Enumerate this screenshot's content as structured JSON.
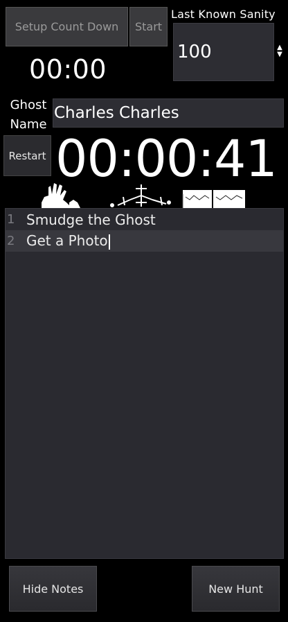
{
  "header": {
    "setup_countdown_label": "Setup Count Down",
    "start_label": "Start",
    "countdown_display": "00:00",
    "sanity_label": "Last Known Sanity",
    "sanity_value": "100"
  },
  "ghost": {
    "name_label": "Ghost\nName",
    "name_value": "Charles Charles"
  },
  "timer": {
    "restart_label": "Restart",
    "elapsed": "00:00:41"
  },
  "evidence": {
    "icons": [
      "handprint-icon",
      "ghost-orb-icon",
      "ghost-writing-icon"
    ]
  },
  "notes": {
    "lines": [
      {
        "number": "1",
        "text": "Smudge the Ghost"
      },
      {
        "number": "2",
        "text": "Get a Photo"
      }
    ]
  },
  "footer": {
    "hide_notes_label": "Hide Notes",
    "new_hunt_label": "New Hunt"
  }
}
